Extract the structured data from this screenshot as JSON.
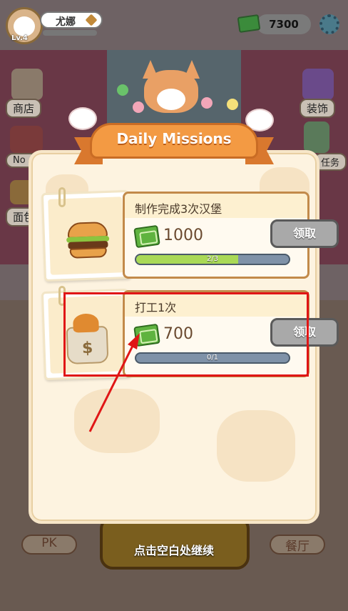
{
  "player": {
    "name": "尤娜",
    "level": "Lv.4"
  },
  "currency": {
    "amount": "7300"
  },
  "side_buttons": {
    "shop": "商店",
    "decor": "装饰",
    "no_ads": "No A",
    "tasks": "任务",
    "bread": "面包"
  },
  "bottom": {
    "pk": "PK",
    "restaurant": "餐厅",
    "continue_hint": "点击空白处继续"
  },
  "dialog": {
    "title": "Daily Missions",
    "missions": [
      {
        "task": "制作完成3次汉堡",
        "reward": "1000",
        "claim_label": "领取",
        "progress_text": "2/3",
        "progress_fraction": 0.667,
        "icon": "burger-icon"
      },
      {
        "task": "打工1次",
        "reward": "700",
        "claim_label": "领取",
        "progress_text": "0/1",
        "progress_fraction": 0,
        "icon": "money-bag-icon"
      }
    ]
  },
  "colors": {
    "highlight": "#e01616",
    "banner": "#f39a43",
    "progress_fill": "#a9d956",
    "claim_disabled": "#a9a9a9"
  }
}
